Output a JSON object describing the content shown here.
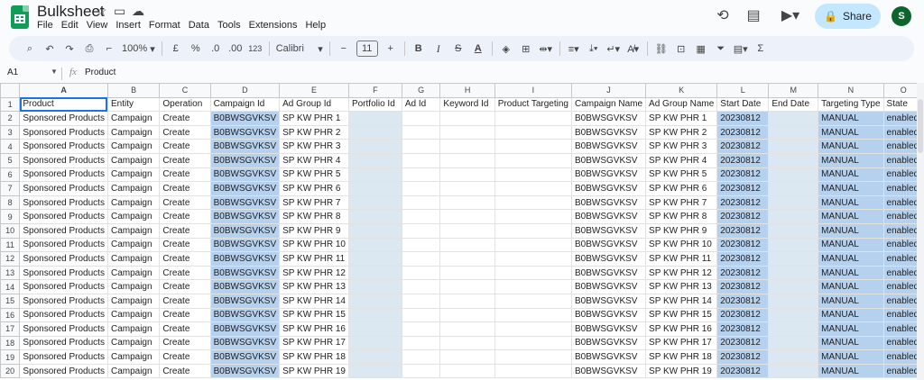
{
  "app": {
    "title": "Bulksheet",
    "menus": [
      "File",
      "Edit",
      "View",
      "Insert",
      "Format",
      "Data",
      "Tools",
      "Extensions",
      "Help"
    ],
    "share_label": "Share",
    "avatar_letter": "S"
  },
  "toolbar": {
    "zoom": "100%",
    "currency": "£",
    "percent": "%",
    "dec_decrease": ".0",
    "dec_increase": ".00",
    "number_format": "123",
    "font": "Calibri",
    "font_size": "11",
    "bold": "B",
    "italic": "I",
    "strike": "S",
    "text_color": "A",
    "sum": "Σ"
  },
  "formula_bar": {
    "cell_ref": "A1",
    "fx": "fx",
    "content": "Product"
  },
  "sheet": {
    "columns": [
      "A",
      "B",
      "C",
      "D",
      "E",
      "F",
      "G",
      "H",
      "I",
      "J",
      "K",
      "L",
      "M",
      "N",
      "O"
    ],
    "headers": [
      "Product",
      "Entity",
      "Operation",
      "Campaign Id",
      "Ad Group Id",
      "Portfolio Id",
      "Ad Id",
      "Keyword Id",
      "Product Targeting",
      "Campaign Name",
      "Ad Group Name",
      "Start Date",
      "End Date",
      "Targeting Type",
      "State"
    ],
    "rows": [
      [
        "Sponsored Products",
        "Campaign",
        "Create",
        "B0BWSGVKSV",
        "SP KW PHR 1",
        "",
        "",
        "",
        "",
        "B0BWSGVKSV",
        "SP KW PHR 1",
        "20230812",
        "",
        "MANUAL",
        "enabled"
      ],
      [
        "Sponsored Products",
        "Campaign",
        "Create",
        "B0BWSGVKSV",
        "SP KW PHR 2",
        "",
        "",
        "",
        "",
        "B0BWSGVKSV",
        "SP KW PHR 2",
        "20230812",
        "",
        "MANUAL",
        "enabled"
      ],
      [
        "Sponsored Products",
        "Campaign",
        "Create",
        "B0BWSGVKSV",
        "SP KW PHR 3",
        "",
        "",
        "",
        "",
        "B0BWSGVKSV",
        "SP KW PHR 3",
        "20230812",
        "",
        "MANUAL",
        "enabled"
      ],
      [
        "Sponsored Products",
        "Campaign",
        "Create",
        "B0BWSGVKSV",
        "SP KW PHR 4",
        "",
        "",
        "",
        "",
        "B0BWSGVKSV",
        "SP KW PHR 4",
        "20230812",
        "",
        "MANUAL",
        "enabled"
      ],
      [
        "Sponsored Products",
        "Campaign",
        "Create",
        "B0BWSGVKSV",
        "SP KW PHR 5",
        "",
        "",
        "",
        "",
        "B0BWSGVKSV",
        "SP KW PHR 5",
        "20230812",
        "",
        "MANUAL",
        "enabled"
      ],
      [
        "Sponsored Products",
        "Campaign",
        "Create",
        "B0BWSGVKSV",
        "SP KW PHR 6",
        "",
        "",
        "",
        "",
        "B0BWSGVKSV",
        "SP KW PHR 6",
        "20230812",
        "",
        "MANUAL",
        "enabled"
      ],
      [
        "Sponsored Products",
        "Campaign",
        "Create",
        "B0BWSGVKSV",
        "SP KW PHR 7",
        "",
        "",
        "",
        "",
        "B0BWSGVKSV",
        "SP KW PHR 7",
        "20230812",
        "",
        "MANUAL",
        "enabled"
      ],
      [
        "Sponsored Products",
        "Campaign",
        "Create",
        "B0BWSGVKSV",
        "SP KW PHR 8",
        "",
        "",
        "",
        "",
        "B0BWSGVKSV",
        "SP KW PHR 8",
        "20230812",
        "",
        "MANUAL",
        "enabled"
      ],
      [
        "Sponsored Products",
        "Campaign",
        "Create",
        "B0BWSGVKSV",
        "SP KW PHR 9",
        "",
        "",
        "",
        "",
        "B0BWSGVKSV",
        "SP KW PHR 9",
        "20230812",
        "",
        "MANUAL",
        "enabled"
      ],
      [
        "Sponsored Products",
        "Campaign",
        "Create",
        "B0BWSGVKSV",
        "SP KW PHR 10",
        "",
        "",
        "",
        "",
        "B0BWSGVKSV",
        "SP KW PHR 10",
        "20230812",
        "",
        "MANUAL",
        "enabled"
      ],
      [
        "Sponsored Products",
        "Campaign",
        "Create",
        "B0BWSGVKSV",
        "SP KW PHR 11",
        "",
        "",
        "",
        "",
        "B0BWSGVKSV",
        "SP KW PHR 11",
        "20230812",
        "",
        "MANUAL",
        "enabled"
      ],
      [
        "Sponsored Products",
        "Campaign",
        "Create",
        "B0BWSGVKSV",
        "SP KW PHR 12",
        "",
        "",
        "",
        "",
        "B0BWSGVKSV",
        "SP KW PHR 12",
        "20230812",
        "",
        "MANUAL",
        "enabled"
      ],
      [
        "Sponsored Products",
        "Campaign",
        "Create",
        "B0BWSGVKSV",
        "SP KW PHR 13",
        "",
        "",
        "",
        "",
        "B0BWSGVKSV",
        "SP KW PHR 13",
        "20230812",
        "",
        "MANUAL",
        "enabled"
      ],
      [
        "Sponsored Products",
        "Campaign",
        "Create",
        "B0BWSGVKSV",
        "SP KW PHR 14",
        "",
        "",
        "",
        "",
        "B0BWSGVKSV",
        "SP KW PHR 14",
        "20230812",
        "",
        "MANUAL",
        "enabled"
      ],
      [
        "Sponsored Products",
        "Campaign",
        "Create",
        "B0BWSGVKSV",
        "SP KW PHR 15",
        "",
        "",
        "",
        "",
        "B0BWSGVKSV",
        "SP KW PHR 15",
        "20230812",
        "",
        "MANUAL",
        "enabled"
      ],
      [
        "Sponsored Products",
        "Campaign",
        "Create",
        "B0BWSGVKSV",
        "SP KW PHR 16",
        "",
        "",
        "",
        "",
        "B0BWSGVKSV",
        "SP KW PHR 16",
        "20230812",
        "",
        "MANUAL",
        "enabled"
      ],
      [
        "Sponsored Products",
        "Campaign",
        "Create",
        "B0BWSGVKSV",
        "SP KW PHR 17",
        "",
        "",
        "",
        "",
        "B0BWSGVKSV",
        "SP KW PHR 17",
        "20230812",
        "",
        "MANUAL",
        "enabled"
      ],
      [
        "Sponsored Products",
        "Campaign",
        "Create",
        "B0BWSGVKSV",
        "SP KW PHR 18",
        "",
        "",
        "",
        "",
        "B0BWSGVKSV",
        "SP KW PHR 18",
        "20230812",
        "",
        "MANUAL",
        "enabled"
      ],
      [
        "Sponsored Products",
        "Campaign",
        "Create",
        "B0BWSGVKSV",
        "SP KW PHR 19",
        "",
        "",
        "",
        "",
        "B0BWSGVKSV",
        "SP KW PHR 19",
        "20230812",
        "",
        "MANUAL",
        "enabled"
      ]
    ]
  },
  "colors": {
    "share_bg": "#c2e7ff",
    "selection_blue": "#b6d1ee",
    "selection_light": "#dbe8f1",
    "brand_green": "#0f9d58"
  }
}
